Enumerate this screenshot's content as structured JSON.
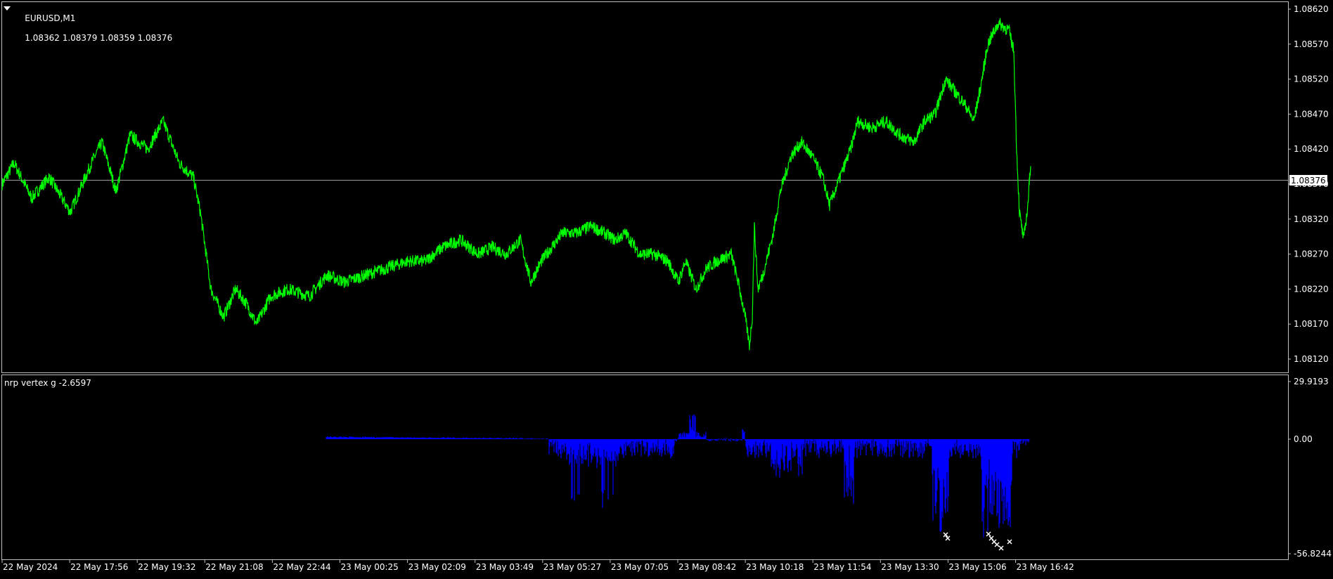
{
  "main_chart": {
    "symbol_label": "EURUSD,M1",
    "ohlc": "1.08362 1.08379 1.08359 1.08376",
    "current_price": "1.08376",
    "price_labels": [
      "1.08620",
      "1.08570",
      "1.08520",
      "1.08470",
      "1.08420",
      "1.08370",
      "1.08320",
      "1.08270",
      "1.08220",
      "1.08170",
      "1.08120"
    ],
    "line_color": "#00ff00"
  },
  "indicator": {
    "label": "nrp vertex g -2.6597",
    "scale_labels": [
      "29.9193",
      "0.00",
      "-56.8244"
    ],
    "bar_color": "#0000ff",
    "marker_color": "#ffffff"
  },
  "time_axis": {
    "labels": [
      "22 May 2024",
      "22 May 17:56",
      "22 May 19:32",
      "22 May 21:08",
      "22 May 22:44",
      "23 May 00:25",
      "23 May 02:09",
      "23 May 03:49",
      "23 May 05:27",
      "23 May 07:05",
      "23 May 08:42",
      "23 May 10:18",
      "23 May 11:54",
      "23 May 13:30",
      "23 May 15:06",
      "23 May 16:42"
    ]
  },
  "chart_data": {
    "type": "line",
    "title": "",
    "xlabel": "",
    "ylabel": "",
    "ylim": [
      1.08105,
      1.08635
    ],
    "x": [
      "22 May 2024",
      "22 May 17:56",
      "22 May 19:32",
      "22 May 21:08",
      "22 May 22:44",
      "23 May 00:25",
      "23 May 02:09",
      "23 May 03:49",
      "23 May 05:27",
      "23 May 07:05",
      "23 May 08:42",
      "23 May 10:18",
      "23 May 11:54",
      "23 May 13:30",
      "23 May 15:06",
      "23 May 16:42"
    ],
    "series": [
      {
        "values": [
          1.0837,
          1.0841,
          1.0842,
          1.082,
          1.0821,
          1.0822,
          1.0825,
          1.0827,
          1.083,
          1.083,
          1.0825,
          1.084,
          1.0845,
          1.0848,
          1.0852,
          1.0838
        ]
      }
    ]
  }
}
